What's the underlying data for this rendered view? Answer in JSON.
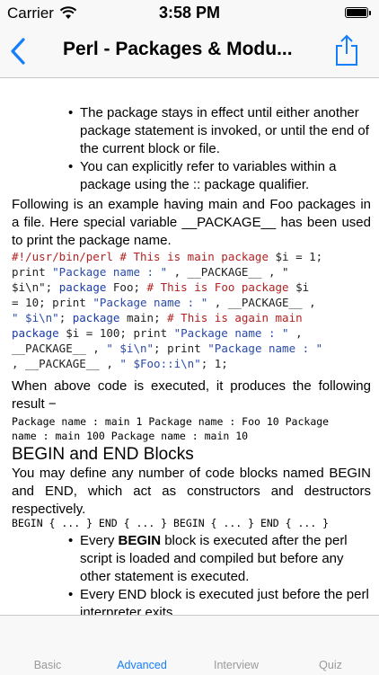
{
  "status_bar": {
    "carrier": "Carrier",
    "time": "3:58 PM"
  },
  "nav": {
    "title": "Perl - Packages & Modu..."
  },
  "content": {
    "bullets_top": [
      "The package stays in effect until either another package statement is invoked, or until the end of the current block or file.",
      "You can explicitly refer to variables within a package using the :: package qualifier."
    ],
    "para_example": "Following is an example having main and Foo packages in a file. Here special variable __PACKAGE__ has been used to print the package name.",
    "code_lines": [
      "#!/usr/bin/perl  # This is main package $i = 1;",
      " print \"Package name : \" , __PACKAGE__ , \"",
      "$i\\n\";   package Foo; # This is Foo package $i",
      "= 10;  print \"Package name : \" , __PACKAGE__ ,",
      "\" $i\\n\";   package main; # This is again main",
      "package $i = 100;  print \"Package name : \" ,",
      "__PACKAGE__ , \" $i\\n\";  print \"Package name : \"",
      ", __PACKAGE__ ,  \" $Foo::i\\n\";    1;"
    ],
    "para_result": "When above code is executed, it produces the following result −",
    "output_lines": [
      "Package name : main 1 Package name : Foo 10 Package",
      "name : main 100 Package name : main 10"
    ],
    "heading_begin_end": "BEGIN and END Blocks",
    "para_begin_end": "You may define any number of code blocks named BEGIN and END, which act as constructors and destructors respectively.",
    "code_begin_end": "BEGIN { ... } END { ... } BEGIN { ... } END { ... }",
    "bullets_bottom": [
      {
        "prefix": "Every ",
        "bold": "BEGIN",
        "suffix": " block is executed after the perl script is loaded and compiled but before any other statement is executed."
      },
      {
        "prefix": "Every END block is executed just before the perl interpreter exits.",
        "bold": "",
        "suffix": ""
      }
    ],
    "bullet_symbol": "•"
  },
  "tabs": [
    {
      "label": "Basic",
      "active": false
    },
    {
      "label": "Advanced",
      "active": true
    },
    {
      "label": "Interview",
      "active": false
    },
    {
      "label": "Quiz",
      "active": false
    }
  ],
  "colors": {
    "accent": "#147efb",
    "comment": "#b22222",
    "string": "#2a4aa8"
  },
  "icons": {
    "back": "chevron-left-icon",
    "share": "share-icon",
    "wifi": "wifi-icon",
    "battery": "battery-icon"
  }
}
